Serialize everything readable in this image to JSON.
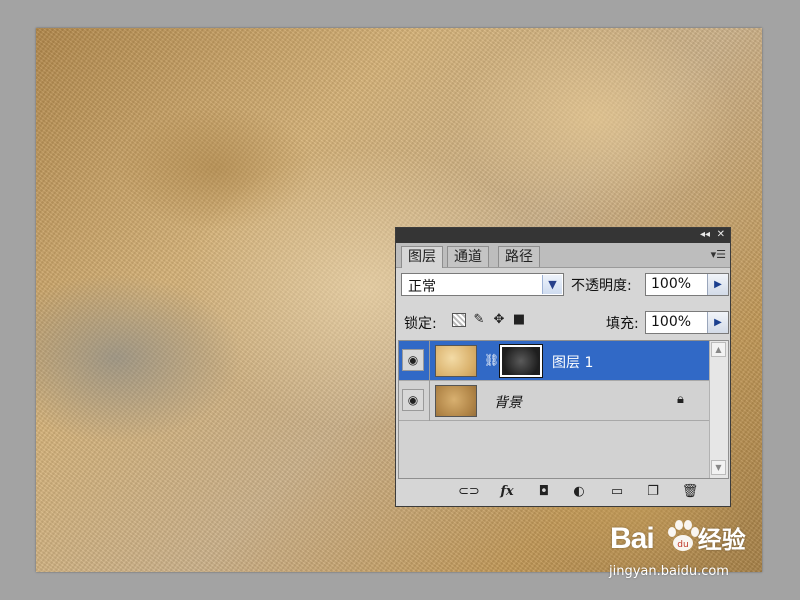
{
  "panel": {
    "tabs": [
      {
        "label": "图层"
      },
      {
        "label": "通道"
      },
      {
        "label": "路径"
      }
    ],
    "titlebar": {
      "collapse_glyph": "◂◂",
      "close_glyph": "✕"
    },
    "menu_glyph": "▾☰",
    "blend_mode": "正常",
    "opacity_label": "不透明度:",
    "opacity_value": "100%",
    "lock_label": "锁定:",
    "fill_label": "填充:",
    "fill_value": "100%",
    "layers": [
      {
        "name": "图层 1",
        "selected": true,
        "has_mask": true
      },
      {
        "name": "背景",
        "selected": false,
        "locked": true
      }
    ],
    "bottom_icons": [
      "link-icon",
      "fx-icon",
      "mask-icon",
      "adjustment-icon",
      "folder-icon",
      "new-layer-icon",
      "trash-icon"
    ],
    "fx_label": "fx"
  },
  "watermark": {
    "brand": "Bai",
    "brand_suffix": "经验",
    "url": "jingyan.baidu.com"
  },
  "colors": {
    "selected_layer": "#3169c6",
    "panel_bg": "#d6d6d6",
    "titlebar": "#353535"
  }
}
